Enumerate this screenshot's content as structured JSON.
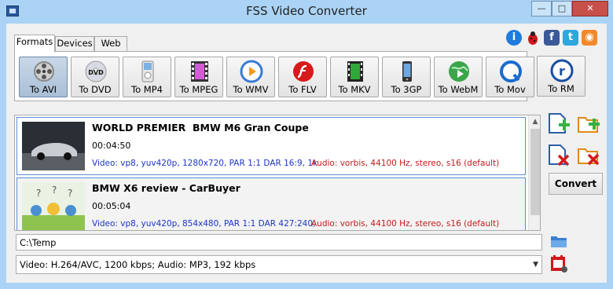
{
  "window": {
    "title": "FSS Video Converter",
    "minimize": "—",
    "maximize": "□",
    "close": "✕"
  },
  "tabs": [
    {
      "label": "Formats"
    },
    {
      "label": "Devices"
    },
    {
      "label": "Web"
    }
  ],
  "formats": [
    {
      "label": "To AVI",
      "icon": "film-reel-icon"
    },
    {
      "label": "To DVD",
      "icon": "dvd-disc-icon"
    },
    {
      "label": "To MP4",
      "icon": "ipod-icon"
    },
    {
      "label": "To MPEG",
      "icon": "mpeg-filmstrip-icon"
    },
    {
      "label": "To WMV",
      "icon": "windows-media-icon"
    },
    {
      "label": "To FLV",
      "icon": "flash-icon"
    },
    {
      "label": "To MKV",
      "icon": "mkv-filmstrip-icon"
    },
    {
      "label": "To 3GP",
      "icon": "mobile-phone-icon"
    },
    {
      "label": "To WebM",
      "icon": "webm-globe-icon"
    },
    {
      "label": "To Mov",
      "icon": "quicktime-icon"
    },
    {
      "label": "To RM",
      "icon": "realmedia-icon"
    }
  ],
  "social": {
    "info": "i",
    "facebook": "f",
    "twitter": "t",
    "rss": "◉"
  },
  "files": [
    {
      "name": "WORLD PREMIER  BMW M6 Gran Coupe",
      "duration": "00:04:50",
      "video": "Video: vp8, yuv420p, 1280x720, PAR 1:1 DAR 16:9, 1k",
      "audio": "Audio: vorbis, 44100 Hz, stereo, s16 (default)"
    },
    {
      "name": "BMW X6 review - CarBuyer",
      "duration": "00:05:04",
      "video": "Video: vp8, yuv420p, 854x480, PAR 1:1 DAR 427:240,",
      "audio": "Audio: vorbis, 44100 Hz, stereo, s16 (default)"
    }
  ],
  "actions": {
    "convert": "Convert"
  },
  "output": {
    "path": "C:\\Temp",
    "preset": "Video: H.264/AVC, 1200 kbps; Audio: MP3, 192 kbps"
  },
  "colors": {
    "title_bar": "#aad3f5",
    "video_info": "#1a35c8",
    "audio_info": "#c41a1a",
    "selection_border": "#5a8fd0"
  }
}
